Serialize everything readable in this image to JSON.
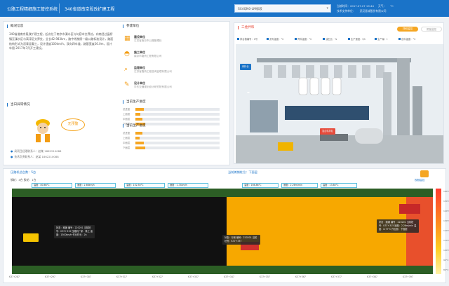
{
  "header": {
    "system": "公路工程精细施工管控系统",
    "project": "340省道南京段改扩建工程",
    "selector": "SX4QN0-LM标段",
    "meta": [
      "当前时间：2017.07.27 19:44",
      "天气：",
      "°C",
      "技术支持单位：",
      "武汉慧诚股份有限公司"
    ]
  },
  "overview": {
    "title": "概况信息",
    "text": "340省道南京段改扩建工程，起点位于南京市溧水区与句容市交界处，向南经过晶桥镇至溧水区与高淳区交界处，全长42.983km，路中线按照一级公路标准设计，路面结构形式为沥青混凝土，设计速度100km/h，双向四车道，路基宽度26.0m，设计年限 2017年7月开工建设。"
  },
  "units": {
    "title": "参建单位",
    "items": [
      {
        "name": "建设单位",
        "value": "江苏省南京市公路管理处"
      },
      {
        "name": "施工单位",
        "value": "南京市路桥工程有限公司"
      },
      {
        "name": "监理单位",
        "value": "江苏省路桥工程咨询监理有限公司"
      },
      {
        "name": "设计单位",
        "value": "华东交通规划设计研究院有限公司"
      }
    ]
  },
  "progress": {
    "title": "当前生产进度",
    "rows": [
      {
        "label": "总进度",
        "value": 0.1
      },
      {
        "label": "上面层",
        "value": 0.06
      },
      {
        "label": "中面层",
        "value": 0.08
      },
      {
        "label": "下面层",
        "value": 0.12
      }
    ],
    "rows2": [
      {
        "label": "总进度",
        "value": 0.08
      },
      {
        "label": "上面层",
        "value": 0.05
      },
      {
        "label": "中面层",
        "value": 0.1
      },
      {
        "label": "下面层",
        "value": 0.12
      }
    ],
    "plan_title": "当前生产进度"
  },
  "alarm": {
    "title": "当日异常情况",
    "bubble": "无预警",
    "contacts": [
      "局项目经理联系人：赵某 1862210088",
      "技术负责联系人：赵某 1862210088"
    ]
  },
  "scene": {
    "title": "三维拌和",
    "tab1": "拌和监控",
    "tab2": "质量监控",
    "gauges": [
      "拌合楼编号：1号",
      "沥青温度：°C",
      "骨料温度：°C",
      "油石比：%",
      "生产速度：t/h",
      "生产量：t",
      "出料温度：°C"
    ],
    "labels": [
      "骨料仓",
      "混合料拌缸",
      "矿粉仓",
      "沥青罐"
    ]
  },
  "paving": {
    "title1": "压路机总台数：5台",
    "sub1": "钢轮：4台 胶轮：1台",
    "title2": "当前摊铺桩位：下面层",
    "video": "视频监控",
    "readouts": [
      "温度：80.66°C",
      "速度：2.66km/h",
      "温度：152.50°C",
      "速度：1.74km/h",
      "温度：166.86°C",
      "速度：2.26m/min",
      "温度：13.80°C"
    ],
    "ruler": [
      "K37+287",
      "K37+297",
      "K37+307",
      "K37+317",
      "K37+327",
      "K37+337",
      "K37+347",
      "K37+357",
      "K37+367",
      "K37+377",
      "K37+387",
      "K37+397"
    ],
    "popups": [
      "状态：摊铺 编号：220201 当前桩号：K37+315 压路机厂家：徐工 温度：1300km/h 作业时长：2h",
      "状态：行驶 编号：220201 当前桩号：K37+337",
      "状态：摊铺 编号：220201 当前桩号：K37+315 速度：2.26m/min 温度：8.77°C 作业层：下面层"
    ],
    "legend": [
      "160°C",
      "150°C",
      "140°C",
      "130°C",
      "120°C",
      "110°C",
      "100°C",
      "90°C",
      "80°C"
    ]
  }
}
